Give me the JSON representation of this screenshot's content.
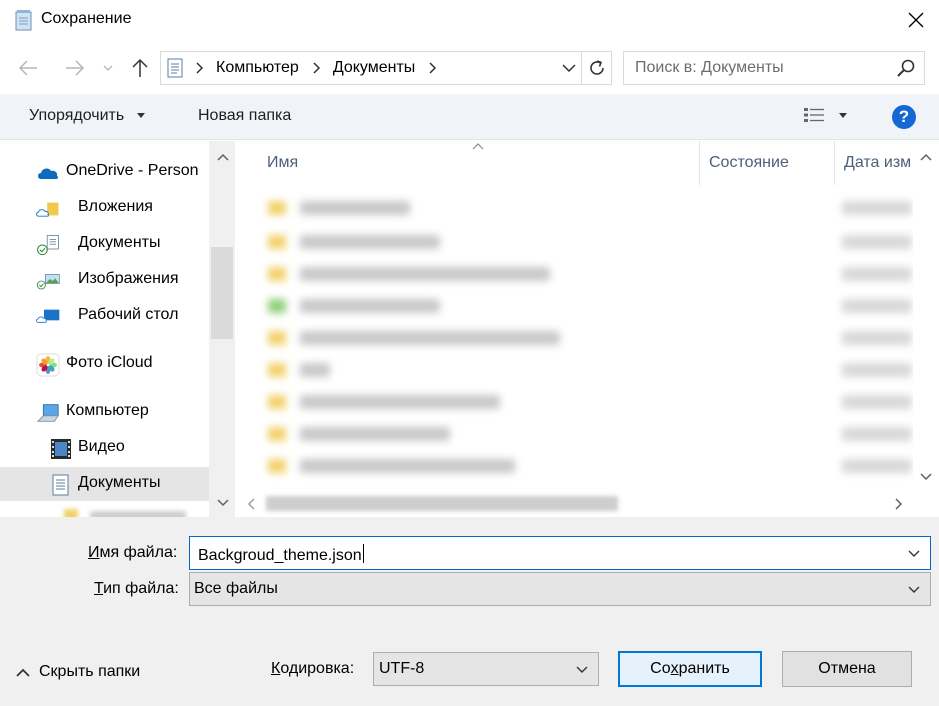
{
  "window": {
    "title": "Сохранение"
  },
  "address": {
    "segments": [
      "Компьютер",
      "Документы"
    ]
  },
  "search": {
    "placeholder": "Поиск в: Документы"
  },
  "toolbar": {
    "organize_label": "Упорядочить",
    "new_folder_label": "Новая папка",
    "help_label": "?"
  },
  "nav_tree": {
    "items": [
      {
        "label": "OneDrive - Person",
        "icon": "onedrive-cloud-icon"
      },
      {
        "label": "Вложения",
        "icon": "folder-icon"
      },
      {
        "label": "Документы",
        "icon": "documents-icon"
      },
      {
        "label": "Изображения",
        "icon": "pictures-icon"
      },
      {
        "label": "Рабочий стол",
        "icon": "desktop-icon"
      },
      {
        "label": "Фото iCloud",
        "icon": "icloud-photos-icon"
      },
      {
        "label": "Компьютер",
        "icon": "computer-icon"
      },
      {
        "label": "Видео",
        "icon": "video-icon"
      },
      {
        "label": "Документы",
        "icon": "documents-icon",
        "selected": true
      }
    ]
  },
  "file_list": {
    "columns": {
      "name": "Имя",
      "status": "Состояние",
      "date": "Дата изм"
    }
  },
  "form": {
    "filename_label_u": "И",
    "filename_label_rest": "мя файла:",
    "filename_value": "Backgroud_theme.json",
    "filetype_label_u": "Т",
    "filetype_label_rest": "ип файла:",
    "filetype_value": "Все файлы",
    "hide_folders_label": "Скрыть папки",
    "encoding_label_u": "К",
    "encoding_label_rest": "одировка:",
    "encoding_value": "UTF-8",
    "save_label_a": "Со",
    "save_label_u": "х",
    "save_label_b": "ранить",
    "cancel_label": "Отмена"
  },
  "colors": {
    "accent": "#0078d7",
    "help": "#1567d3",
    "toolbar_bg": "#f0f4f9",
    "selected_bg": "#e5e5e5"
  }
}
